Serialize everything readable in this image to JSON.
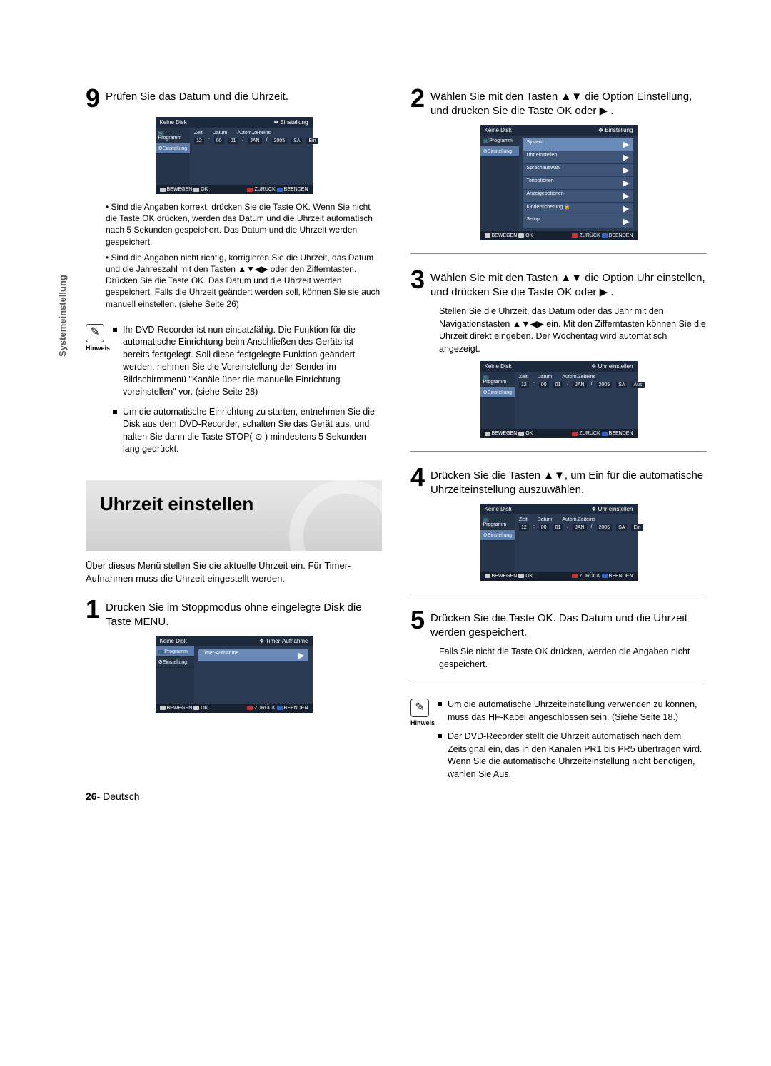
{
  "sideLabel": "Systemeinstellung",
  "left": {
    "step9": {
      "num": "9",
      "text": "Prüfen Sie das Datum und die Uhrzeit."
    },
    "osd9": {
      "noDisk": "Keine Disk",
      "crumb": "Einstellung",
      "side1": "Programm",
      "side2": "Einstellung",
      "h1": "Zeit",
      "h2": "Datum",
      "h3": "Autom.Zeiteins",
      "r1": "12",
      "r2": "00",
      "r3": "01",
      "r4": "JAN",
      "r5": "2005",
      "r6": "SA",
      "r7": "Ein",
      "b1": "BEWEGEN",
      "b2": "OK",
      "b3": "ZURÜCK",
      "b4": "BEENDEN"
    },
    "bullets9a": "• Sind die Angaben korrekt, drücken Sie die Taste OK. Wenn Sie nicht die Taste OK drücken, werden das Datum und die Uhrzeit automatisch nach 5 Sekunden gespeichert. Das Datum und die Uhrzeit werden gespeichert.",
    "bullets9b": "• Sind die Angaben nicht richtig, korrigieren Sie die Uhrzeit, das Datum und die Jahreszahl mit den Tasten ▲▼◀▶ oder den Zifferntasten. Drücken Sie die Taste OK. Das Datum und die Uhrzeit werden gespeichert. Falls die Uhrzeit geändert werden soll, können Sie sie auch manuell einstellen. (siehe Seite 26)",
    "note1": {
      "label": "Hinweis",
      "i1": "Ihr DVD-Recorder ist nun einsatzfähig. Die Funktion für die automatische Einrichtung beim Anschließen des Geräts ist bereits festgelegt. Soll diese festgelegte Funktion geändert werden, nehmen Sie die Voreinstellung der Sender im Bildschirmmenü \"Kanäle über die manuelle Einrichtung voreinstellen\" vor. (siehe Seite 28)",
      "i2": "Um die automatische Einrichtung zu starten, entnehmen Sie die Disk aus dem DVD-Recorder, schalten Sie das Gerät aus, und halten Sie dann die Taste STOP( ⊙ ) mindestens 5 Sekunden lang gedrückt."
    },
    "heading": "Uhrzeit einstellen",
    "intro": "Über dieses Menü stellen Sie die aktuelle Uhrzeit ein. Für Timer-Aufnahmen muss die Uhrzeit eingestellt werden.",
    "step1": {
      "num": "1",
      "text": "Drücken Sie im Stoppmodus ohne eingelegte Disk die Taste MENU."
    },
    "osd1": {
      "noDisk": "Keine Disk",
      "crumb": "Timer-Aufnahme",
      "side1": "Programm",
      "side2": "Einstellung",
      "item": "Timer-Aufnahme",
      "b1": "BEWEGEN",
      "b2": "OK",
      "b3": "ZURÜCK",
      "b4": "BEENDEN"
    }
  },
  "right": {
    "step2": {
      "num": "2",
      "text": "Wählen Sie mit den Tasten ▲▼ die Option Einstellung, und drücken Sie die Taste OK oder ▶ ."
    },
    "osd2": {
      "noDisk": "Keine Disk",
      "crumb": "Einstellung",
      "side1": "Programm",
      "side2": "Einstellung",
      "l0": "System",
      "l1": "Uhr einstellen",
      "l2": "Sprachauswahl",
      "l3": "Tonoptionen",
      "l4": "Anzeigeoptionen",
      "l5": "Kindersicherung 🔒",
      "l6": "Setup",
      "b1": "BEWEGEN",
      "b2": "OK",
      "b3": "ZURÜCK",
      "b4": "BEENDEN"
    },
    "step3": {
      "num": "3",
      "text": "Wählen Sie mit den Tasten ▲▼ die Option Uhr einstellen, und drücken Sie die Taste OK oder ▶ .",
      "sub": "Stellen Sie die Uhrzeit, das Datum oder das Jahr mit den Navigationstasten ▲▼◀▶ ein. Mit den Zifferntasten können Sie die Uhrzeit direkt eingeben. Der Wochentag wird automatisch angezeigt."
    },
    "osd3": {
      "noDisk": "Keine Disk",
      "crumb": "Uhr einstellen",
      "side1": "Programm",
      "side2": "Einstellung",
      "h1": "Zeit",
      "h2": "Datum",
      "h3": "Autom.Zeiteins",
      "r1": "12",
      "r2": "00",
      "r3": "01",
      "r4": "JAN",
      "r5": "2005",
      "r6": "SA",
      "r7": "Aus",
      "b1": "BEWEGEN",
      "b2": "OK",
      "b3": "ZURÜCK",
      "b4": "BEENDEN"
    },
    "step4": {
      "num": "4",
      "text": "Drücken Sie die Tasten ▲▼, um Ein für die automatische Uhrzeiteinstellung auszuwählen."
    },
    "osd4": {
      "noDisk": "Keine Disk",
      "crumb": "Uhr einstellen",
      "side1": "Programm",
      "side2": "Einstellung",
      "h1": "Zeit",
      "h2": "Datum",
      "h3": "Autom.Zeiteins",
      "r1": "12",
      "r2": "00",
      "r3": "01",
      "r4": "JAN",
      "r5": "2005",
      "r6": "SA",
      "r7": "Ein",
      "b1": "BEWEGEN",
      "b2": "OK",
      "b3": "ZURÜCK",
      "b4": "BEENDEN"
    },
    "step5": {
      "num": "5",
      "text": "Drücken Sie die Taste OK. Das Datum und die Uhrzeit werden gespeichert.",
      "sub": "Falls Sie nicht die Taste OK drücken, werden die Angaben nicht gespeichert."
    },
    "note2": {
      "label": "Hinweis",
      "i1": "Um die automatische Uhrzeiteinstellung verwenden zu können, muss das HF-Kabel angeschlossen sein. (Siehe Seite 18.)",
      "i2": "Der DVD-Recorder stellt die Uhrzeit automatisch nach dem Zeitsignal ein, das in den Kanälen PR1 bis PR5 übertragen wird. Wenn Sie die automatische Uhrzeiteinstellung nicht benötigen, wählen Sie Aus."
    }
  },
  "pageNum": "26",
  "pageLang": "- Deutsch"
}
